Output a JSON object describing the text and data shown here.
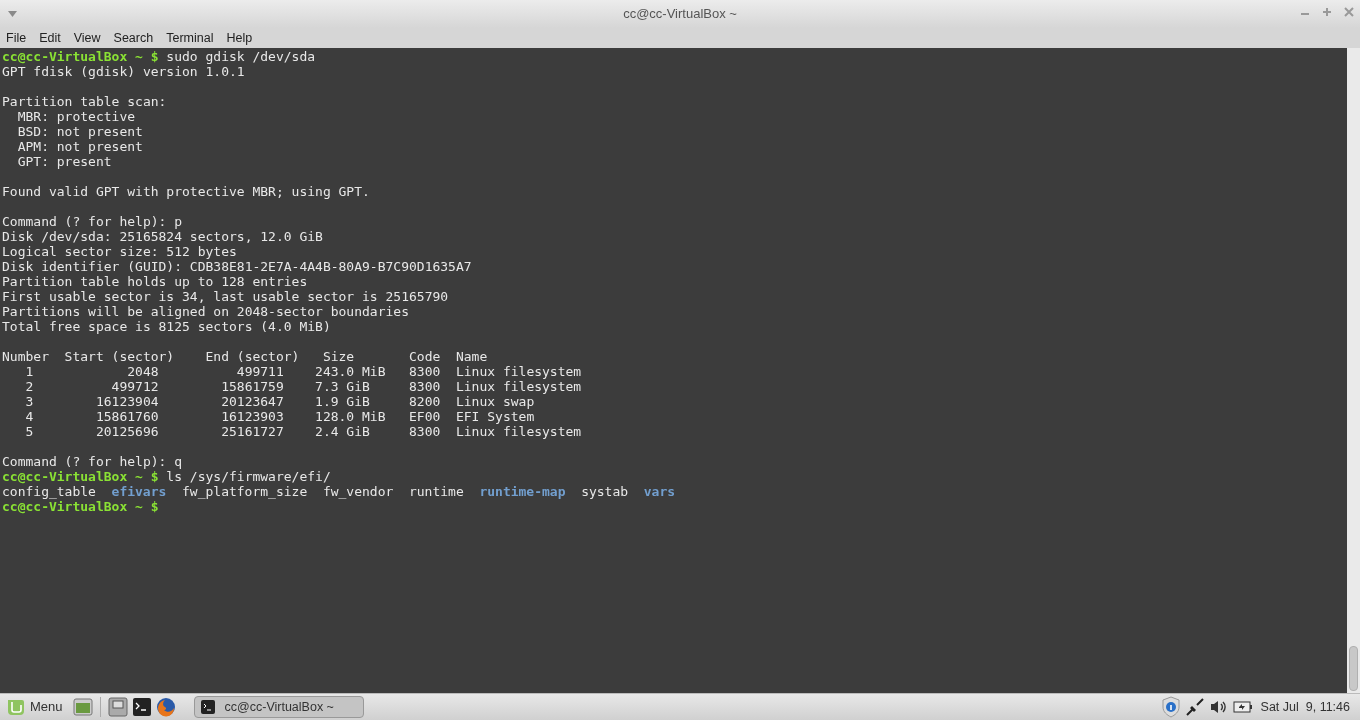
{
  "window": {
    "title": "cc@cc-VirtualBox ~"
  },
  "menu": [
    "File",
    "Edit",
    "View",
    "Search",
    "Terminal",
    "Help"
  ],
  "terminal": {
    "lines": [
      {
        "kind": "text",
        "segments": [
          {
            "kind": "prompt",
            "text": "cc@cc-VirtualBox ~ $"
          },
          {
            "kind": "plain",
            "text": " sudo gdisk /dev/sda"
          }
        ]
      },
      {
        "kind": "text",
        "segments": [
          {
            "kind": "plain",
            "text": "GPT fdisk (gdisk) version 1.0.1"
          }
        ]
      },
      {
        "kind": "blank"
      },
      {
        "kind": "text",
        "segments": [
          {
            "kind": "plain",
            "text": "Partition table scan:"
          }
        ]
      },
      {
        "kind": "text",
        "segments": [
          {
            "kind": "plain",
            "text": "  MBR: protective"
          }
        ]
      },
      {
        "kind": "text",
        "segments": [
          {
            "kind": "plain",
            "text": "  BSD: not present"
          }
        ]
      },
      {
        "kind": "text",
        "segments": [
          {
            "kind": "plain",
            "text": "  APM: not present"
          }
        ]
      },
      {
        "kind": "text",
        "segments": [
          {
            "kind": "plain",
            "text": "  GPT: present"
          }
        ]
      },
      {
        "kind": "blank"
      },
      {
        "kind": "text",
        "segments": [
          {
            "kind": "plain",
            "text": "Found valid GPT with protective MBR; using GPT."
          }
        ]
      },
      {
        "kind": "blank"
      },
      {
        "kind": "text",
        "segments": [
          {
            "kind": "plain",
            "text": "Command (? for help): p"
          }
        ]
      },
      {
        "kind": "text",
        "segments": [
          {
            "kind": "plain",
            "text": "Disk /dev/sda: 25165824 sectors, 12.0 GiB"
          }
        ]
      },
      {
        "kind": "text",
        "segments": [
          {
            "kind": "plain",
            "text": "Logical sector size: 512 bytes"
          }
        ]
      },
      {
        "kind": "text",
        "segments": [
          {
            "kind": "plain",
            "text": "Disk identifier (GUID): CDB38E81-2E7A-4A4B-80A9-B7C90D1635A7"
          }
        ]
      },
      {
        "kind": "text",
        "segments": [
          {
            "kind": "plain",
            "text": "Partition table holds up to 128 entries"
          }
        ]
      },
      {
        "kind": "text",
        "segments": [
          {
            "kind": "plain",
            "text": "First usable sector is 34, last usable sector is 25165790"
          }
        ]
      },
      {
        "kind": "text",
        "segments": [
          {
            "kind": "plain",
            "text": "Partitions will be aligned on 2048-sector boundaries"
          }
        ]
      },
      {
        "kind": "text",
        "segments": [
          {
            "kind": "plain",
            "text": "Total free space is 8125 sectors (4.0 MiB)"
          }
        ]
      },
      {
        "kind": "blank"
      },
      {
        "kind": "text",
        "segments": [
          {
            "kind": "plain",
            "text": "Number  Start (sector)    End (sector)   Size       Code  Name"
          }
        ]
      },
      {
        "kind": "text",
        "segments": [
          {
            "kind": "plain",
            "text": "   1            2048          499711    243.0 MiB   8300  Linux filesystem"
          }
        ]
      },
      {
        "kind": "text",
        "segments": [
          {
            "kind": "plain",
            "text": "   2          499712        15861759    7.3 GiB     8300  Linux filesystem"
          }
        ]
      },
      {
        "kind": "text",
        "segments": [
          {
            "kind": "plain",
            "text": "   3        16123904        20123647    1.9 GiB     8200  Linux swap"
          }
        ]
      },
      {
        "kind": "text",
        "segments": [
          {
            "kind": "plain",
            "text": "   4        15861760        16123903    128.0 MiB   EF00  EFI System"
          }
        ]
      },
      {
        "kind": "text",
        "segments": [
          {
            "kind": "plain",
            "text": "   5        20125696        25161727    2.4 GiB     8300  Linux filesystem"
          }
        ]
      },
      {
        "kind": "blank"
      },
      {
        "kind": "text",
        "segments": [
          {
            "kind": "plain",
            "text": "Command (? for help): q"
          }
        ]
      },
      {
        "kind": "text",
        "segments": [
          {
            "kind": "prompt",
            "text": "cc@cc-VirtualBox ~ $"
          },
          {
            "kind": "plain",
            "text": " ls /sys/firmware/efi/"
          }
        ]
      },
      {
        "kind": "listing",
        "segments": [
          {
            "kind": "file",
            "text": "config_table"
          },
          {
            "kind": "dir",
            "text": "efivars"
          },
          {
            "kind": "file",
            "text": "fw_platform_size"
          },
          {
            "kind": "file",
            "text": "fw_vendor"
          },
          {
            "kind": "file",
            "text": "runtime"
          },
          {
            "kind": "dir",
            "text": "runtime-map"
          },
          {
            "kind": "file",
            "text": "systab"
          },
          {
            "kind": "dir",
            "text": "vars"
          }
        ]
      },
      {
        "kind": "text",
        "segments": [
          {
            "kind": "prompt",
            "text": "cc@cc-VirtualBox ~ $"
          }
        ]
      }
    ]
  },
  "taskbar": {
    "menu_label": "Menu",
    "window_button": "cc@cc-VirtualBox ~",
    "clock": "Sat Jul  9, 11:46"
  }
}
